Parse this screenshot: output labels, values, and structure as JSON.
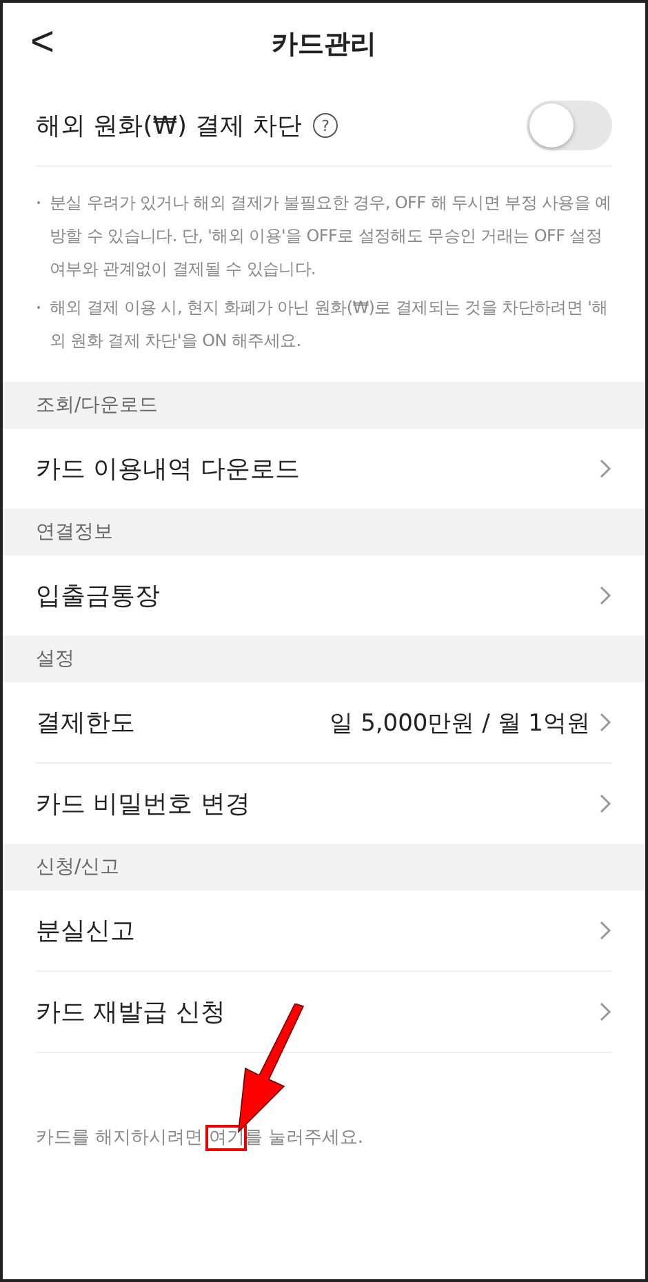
{
  "header": {
    "back": "<",
    "title": "카드관리"
  },
  "toggle": {
    "label": "해외 원화(₩) 결제 차단",
    "help": "?",
    "on": false
  },
  "notes": [
    "분실 우려가 있거나 해외 결제가 불필요한 경우, OFF 해 두시면 부정 사용을 예방할 수 있습니다. 단, '해외 이용'을 OFF로 설정해도 무승인 거래는 OFF 설정 여부와 관계없이 결제될 수 있습니다.",
    "해외 결제 이용 시, 현지 화폐가 아닌 원화(₩)로 결제되는 것을 차단하려면 '해외 원화 결제 차단'을 ON 해주세요."
  ],
  "sections": [
    {
      "header": "조회/다운로드",
      "items": [
        {
          "label": "카드 이용내역 다운로드"
        }
      ]
    },
    {
      "header": "연결정보",
      "items": [
        {
          "label": "입출금통장"
        }
      ]
    },
    {
      "header": "설정",
      "items": [
        {
          "label": "결제한도",
          "value": "일 5,000만원 / 월 1억원"
        },
        {
          "label": "카드 비밀번호 변경"
        }
      ]
    },
    {
      "header": "신청/신고",
      "items": [
        {
          "label": "분실신고"
        },
        {
          "label": "카드 재발급 신청"
        }
      ]
    }
  ],
  "footer": {
    "before": "카드를 해지하시려면 ",
    "link": "여기",
    "after": "를 눌러주세요."
  }
}
